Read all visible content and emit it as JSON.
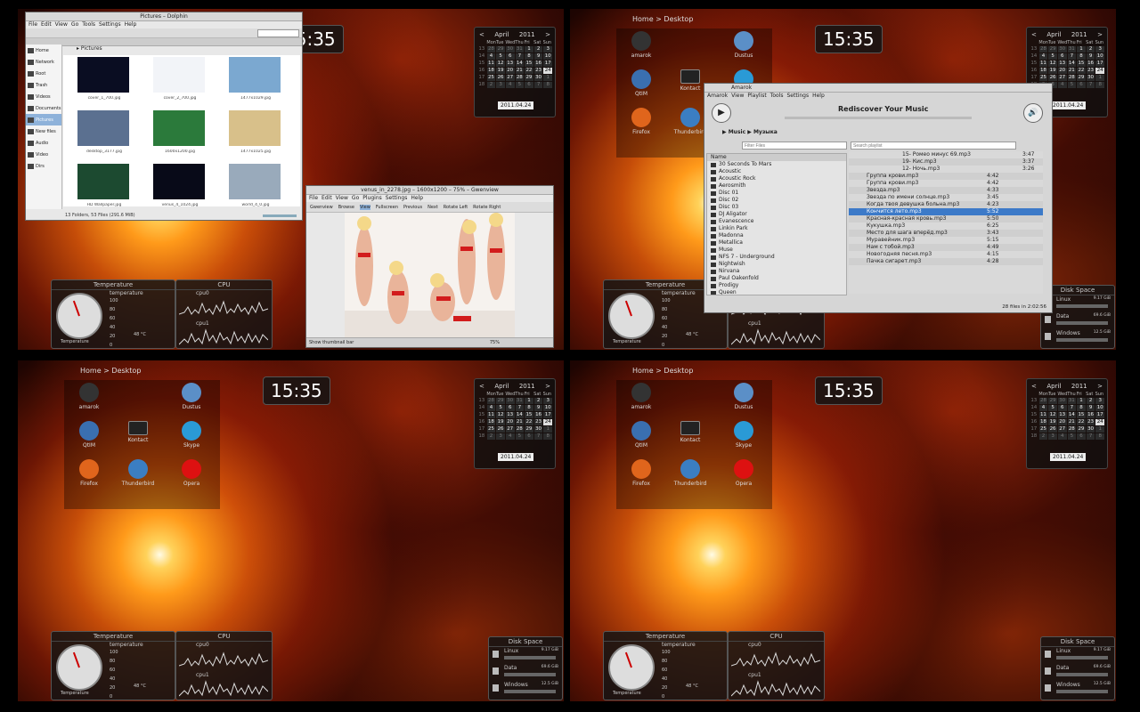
{
  "desktop": {
    "breadcrumb": "Home > Desktop",
    "clock": "15:35",
    "calendar": {
      "month": "April",
      "year": "2011",
      "prev": "<",
      "next": ">",
      "weekdays": [
        "Mon",
        "Tue",
        "Wed",
        "Thu",
        "Fri",
        "Sat",
        "Sun"
      ],
      "weeks": [
        [
          "13",
          "28",
          "29",
          "30",
          "31",
          "1",
          "2",
          "3"
        ],
        [
          "14",
          "4",
          "5",
          "6",
          "7",
          "8",
          "9",
          "10"
        ],
        [
          "15",
          "11",
          "12",
          "13",
          "14",
          "15",
          "16",
          "17"
        ],
        [
          "16",
          "18",
          "19",
          "20",
          "21",
          "22",
          "23",
          "24"
        ],
        [
          "17",
          "25",
          "26",
          "27",
          "28",
          "29",
          "30",
          "1"
        ],
        [
          "18",
          "2",
          "3",
          "4",
          "5",
          "6",
          "7",
          "8"
        ]
      ],
      "date_field": "2011.04.24"
    },
    "icons": [
      "amarok",
      "Dustus",
      "QtIM",
      "Kontact",
      "Skype",
      "Firefox",
      "Thunderbird",
      "Opera"
    ],
    "temperature": {
      "title": "Temperature",
      "label": "temperature",
      "values": [
        "100",
        "80",
        "60",
        "40",
        "20",
        "0"
      ],
      "caption": "Temperature",
      "reading": "48 °C"
    },
    "cpu": {
      "title": "CPU",
      "core0": "cpu0",
      "core1": "cpu1"
    },
    "disk": {
      "title": "Disk Space",
      "items": [
        {
          "name": "Linux",
          "size": "9.17 GiB"
        },
        {
          "name": "Data",
          "size": "69.6 GiB"
        },
        {
          "name": "Windows",
          "size": "12.5 GiB"
        }
      ]
    }
  },
  "dolphin": {
    "title": "Pictures – Dolphin",
    "menu": [
      "File",
      "Edit",
      "View",
      "Go",
      "Tools",
      "Settings",
      "Help"
    ],
    "path": "Pictures",
    "places": [
      "Home",
      "Network",
      "Root",
      "Trash",
      "Videos",
      "Documents",
      "Pictures",
      "New files",
      "Audio",
      "Video",
      "Dirs"
    ],
    "files": [
      "cover_1_700.jpg",
      "cover_2_700.jpg",
      "1477x1029.jpg",
      "desktop_3177.jpg",
      "1600x1200.jpg",
      "1477x1025.jpg",
      "HD Wallpaper.jpg",
      "venus_4_1024.jpg",
      "world_4_0.jpg"
    ],
    "status": "13 Folders, 53 Files (291.6 MiB)"
  },
  "gwenview": {
    "title": "venus_in_2278.jpg – 1600x1200 – 75% – Gwenview",
    "menu": [
      "File",
      "Edit",
      "View",
      "Go",
      "Plugins",
      "Settings",
      "Help"
    ],
    "toolbar": [
      "Gwenview",
      "Browse",
      "View",
      "Fullscreen",
      "Previous",
      "Next",
      "Rotate Left",
      "Rotate Right"
    ],
    "zoom": "75%",
    "status_left": "Show thumbnail bar"
  },
  "amarok": {
    "title": "Amarok",
    "menu": [
      "Amarok",
      "View",
      "Playlist",
      "Tools",
      "Settings",
      "Help"
    ],
    "banner": "Rediscover Your Music",
    "crumbs": [
      "Music",
      "Музыка"
    ],
    "filter_placeholder": "Filter Files",
    "search_placeholder": "Search playlist",
    "column_name": "Name",
    "folders": [
      "30 Seconds To Mars",
      "Acoustic",
      "Acoustic Rock",
      "Aerosmith",
      "Disc 01",
      "Disc 02",
      "Disc 03",
      "DJ Aligator",
      "Evanescence",
      "Linkin Park",
      "Madonna",
      "Metallica",
      "Muse",
      "NFS 7 - Underground",
      "Nightwish",
      "Nirvana",
      "Paul Oakenfold",
      "Prodigy",
      "Queen"
    ],
    "playlist": [
      {
        "title": "15- Ромео минус 69.mp3",
        "len": "3:47"
      },
      {
        "title": "19- Кис.mp3",
        "len": "3:37"
      },
      {
        "title": "12- Ночь.mp3",
        "len": "3:26"
      },
      {
        "title": "Группа крови.mp3",
        "len": "4:42"
      },
      {
        "title": "Группа крови.mp3",
        "len": "4:42"
      },
      {
        "title": "Звезда.mp3",
        "len": "4:33"
      },
      {
        "title": "Звезда по имени солнце.mp3",
        "len": "3:45"
      },
      {
        "title": "Когда твоя девушка больна.mp3",
        "len": "4:23"
      },
      {
        "title": "Кончится лето.mp3",
        "len": "5:52"
      },
      {
        "title": "Красная-красная кровь.mp3",
        "len": "5:50"
      },
      {
        "title": "Кукушка.mp3",
        "len": "6:25"
      },
      {
        "title": "Место для шага вперёд.mp3",
        "len": "3:43"
      },
      {
        "title": "Муравейник.mp3",
        "len": "5:15"
      },
      {
        "title": "Нам с тобой.mp3",
        "len": "4:49"
      },
      {
        "title": "Новогодняя песня.mp3",
        "len": "4:15"
      },
      {
        "title": "Пачка сигарет.mp3",
        "len": "4:28"
      }
    ],
    "status": "28 files in 2:02:56"
  }
}
